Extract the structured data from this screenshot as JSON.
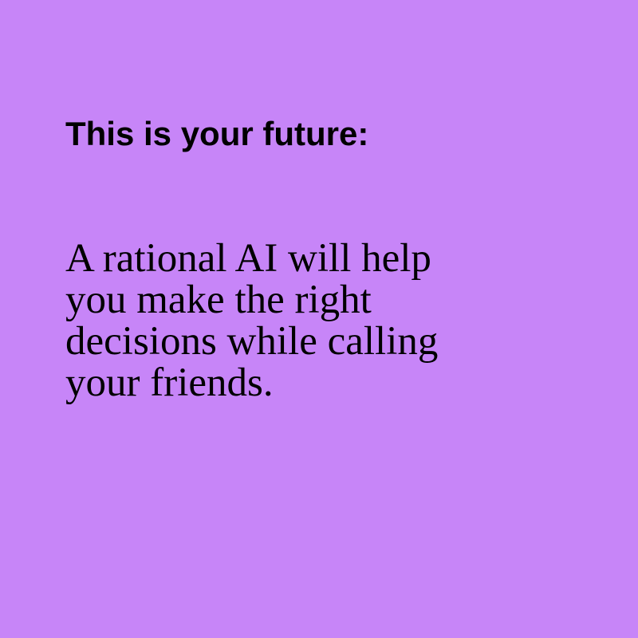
{
  "colors": {
    "background": "#c785f8",
    "text": "#000000"
  },
  "card": {
    "heading": "This is your future:",
    "body_lines": [
      "A rational AI will help",
      "you make the right",
      "decisions while calling",
      "your friends."
    ]
  }
}
